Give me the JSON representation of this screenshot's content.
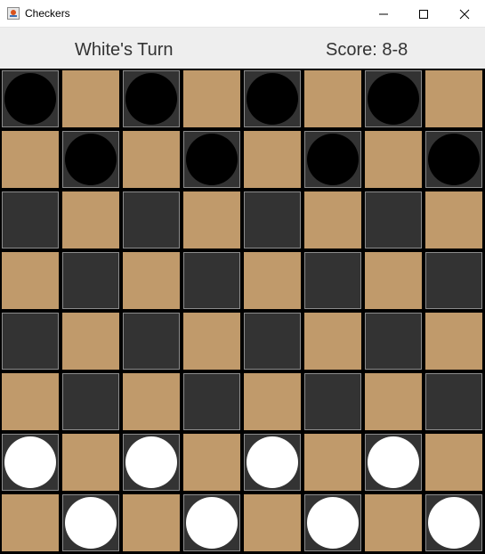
{
  "window": {
    "title": "Checkers",
    "icon": "java-cup-icon"
  },
  "status": {
    "turn": "White's Turn",
    "score": "Score: 8-8"
  },
  "board": {
    "size": 8,
    "colors": {
      "dark": "#333333",
      "light": "#c09a6b",
      "black_piece": "#000000",
      "white_piece": "#ffffff"
    },
    "rows": [
      "bxbxbxbx",
      "xbxbxbxb",
      "........",
      "........",
      "........",
      "........",
      "wxwxwxwx",
      "xwxwxwxw"
    ]
  }
}
